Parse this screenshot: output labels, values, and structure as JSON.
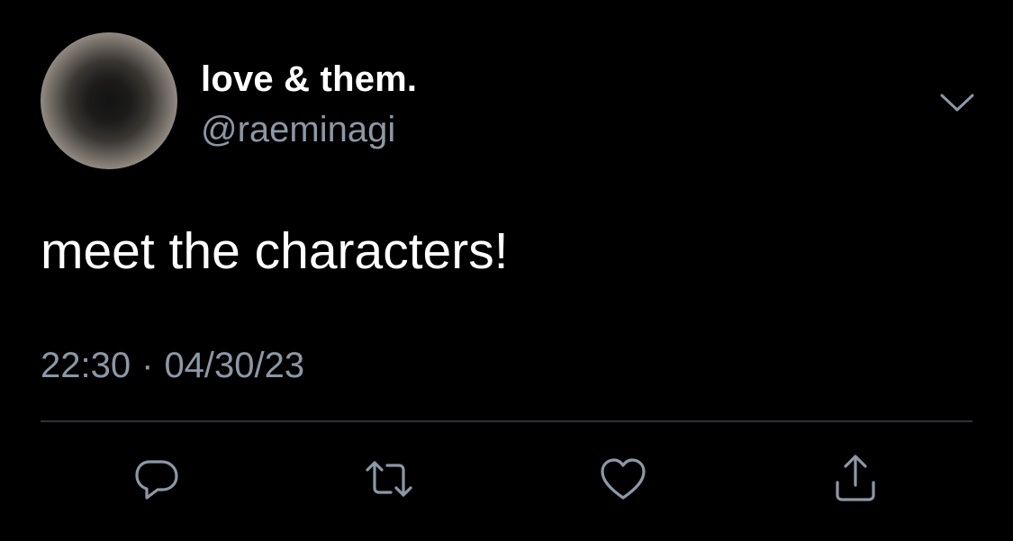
{
  "tweet": {
    "display_name": "love & them.",
    "handle": "@raeminagi",
    "text": "meet the characters!",
    "time": "22:30",
    "separator": "·",
    "date": "04/30/23"
  },
  "icons": {
    "caret": "chevron-down-icon",
    "reply": "reply-icon",
    "retweet": "retweet-icon",
    "like": "heart-icon",
    "share": "share-icon"
  },
  "colors": {
    "background": "#000000",
    "primary_text": "#ffffff",
    "secondary_text": "#8b98a5",
    "divider": "#2f3336"
  }
}
